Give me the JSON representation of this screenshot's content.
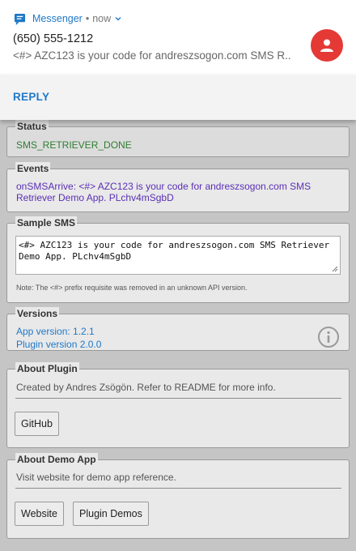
{
  "notification": {
    "app_name": "Messenger",
    "separator": "•",
    "time": "now",
    "sender": "(650) 555-1212",
    "preview": "<#> AZC123 is your code for andreszsogon.com SMS R..",
    "reply_label": "REPLY",
    "accent": "#1f78c8",
    "avatar_color": "#e53935"
  },
  "status": {
    "legend": "Status",
    "value": "SMS_RETRIEVER_DONE"
  },
  "events": {
    "legend": "Events",
    "text": "onSMSArrive: <#> AZC123 is your code for andreszsogon.com SMS Retriever Demo App. PLchv4mSgbD"
  },
  "sample_sms": {
    "legend": "Sample SMS",
    "value": "<#> AZC123 is your code for andreszsogon.com SMS Retriever Demo App. PLchv4mSgbD",
    "note": "Note: The <#> prefix requisite was removed in an unknown API version."
  },
  "versions": {
    "legend": "Versions",
    "app_version": "App version: 1.2.1",
    "plugin_version": "Plugin version 2.0.0",
    "info_icon": "info-icon"
  },
  "about_plugin": {
    "legend": "About Plugin",
    "description": "Created by Andres Zsögön. Refer to README for more info.",
    "github_label": "GitHub"
  },
  "about_demo": {
    "legend": "About Demo App",
    "description": "Visit website for demo app reference.",
    "website_label": "Website",
    "plugin_demos_label": "Plugin Demos"
  }
}
